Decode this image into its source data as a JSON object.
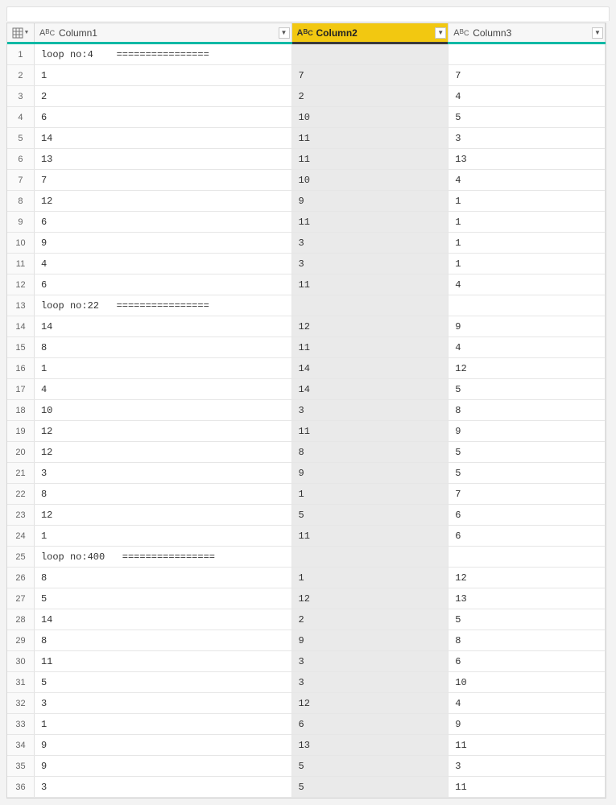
{
  "type_icon_label": "ABC",
  "columns": [
    {
      "name": "Column1",
      "selected": false
    },
    {
      "name": "Column2",
      "selected": true
    },
    {
      "name": "Column3",
      "selected": false
    }
  ],
  "rows": [
    {
      "n": 1,
      "c1": "loop no:4    ================",
      "c2": "",
      "c3": ""
    },
    {
      "n": 2,
      "c1": "1",
      "c2": "7",
      "c3": "7"
    },
    {
      "n": 3,
      "c1": "2",
      "c2": "2",
      "c3": "4"
    },
    {
      "n": 4,
      "c1": "6",
      "c2": "10",
      "c3": "5"
    },
    {
      "n": 5,
      "c1": "14",
      "c2": "11",
      "c3": "3"
    },
    {
      "n": 6,
      "c1": "13",
      "c2": "11",
      "c3": "13"
    },
    {
      "n": 7,
      "c1": "7",
      "c2": "10",
      "c3": "4"
    },
    {
      "n": 8,
      "c1": "12",
      "c2": "9",
      "c3": "1"
    },
    {
      "n": 9,
      "c1": "6",
      "c2": "11",
      "c3": "1"
    },
    {
      "n": 10,
      "c1": "9",
      "c2": "3",
      "c3": "1"
    },
    {
      "n": 11,
      "c1": "4",
      "c2": "3",
      "c3": "1"
    },
    {
      "n": 12,
      "c1": "6",
      "c2": "11",
      "c3": "4"
    },
    {
      "n": 13,
      "c1": "loop no:22   ================",
      "c2": "",
      "c3": ""
    },
    {
      "n": 14,
      "c1": "14",
      "c2": "12",
      "c3": "9"
    },
    {
      "n": 15,
      "c1": "8",
      "c2": "11",
      "c3": "4"
    },
    {
      "n": 16,
      "c1": "1",
      "c2": "14",
      "c3": "12"
    },
    {
      "n": 17,
      "c1": "4",
      "c2": "14",
      "c3": "5"
    },
    {
      "n": 18,
      "c1": "10",
      "c2": "3",
      "c3": "8"
    },
    {
      "n": 19,
      "c1": "12",
      "c2": "11",
      "c3": "9"
    },
    {
      "n": 20,
      "c1": "12",
      "c2": "8",
      "c3": "5"
    },
    {
      "n": 21,
      "c1": "3",
      "c2": "9",
      "c3": "5"
    },
    {
      "n": 22,
      "c1": "8",
      "c2": "1",
      "c3": "7"
    },
    {
      "n": 23,
      "c1": "12",
      "c2": "5",
      "c3": "6"
    },
    {
      "n": 24,
      "c1": "1",
      "c2": "11",
      "c3": "6"
    },
    {
      "n": 25,
      "c1": "loop no:400   ================",
      "c2": "",
      "c3": ""
    },
    {
      "n": 26,
      "c1": "8",
      "c2": "1",
      "c3": "12"
    },
    {
      "n": 27,
      "c1": "5",
      "c2": "12",
      "c3": "13"
    },
    {
      "n": 28,
      "c1": "14",
      "c2": "2",
      "c3": "5"
    },
    {
      "n": 29,
      "c1": "8",
      "c2": "9",
      "c3": "8"
    },
    {
      "n": 30,
      "c1": "11",
      "c2": "3",
      "c3": "6"
    },
    {
      "n": 31,
      "c1": "5",
      "c2": "3",
      "c3": "10"
    },
    {
      "n": 32,
      "c1": "3",
      "c2": "12",
      "c3": "4"
    },
    {
      "n": 33,
      "c1": "1",
      "c2": "6",
      "c3": "9"
    },
    {
      "n": 34,
      "c1": "9",
      "c2": "13",
      "c3": "11"
    },
    {
      "n": 35,
      "c1": "9",
      "c2": "5",
      "c3": "3"
    },
    {
      "n": 36,
      "c1": "3",
      "c2": "5",
      "c3": "11"
    }
  ]
}
